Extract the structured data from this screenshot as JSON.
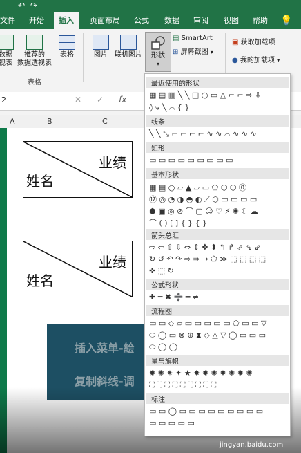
{
  "ribbon_tabs": [
    "文件",
    "开始",
    "插入",
    "页面布局",
    "公式",
    "数据",
    "审阅",
    "视图",
    "帮助"
  ],
  "active_tab": "插入",
  "ribbon": {
    "pivot_label": "数据\n视表",
    "recommended_pivot_label": "推荐的\n数据透视表",
    "table_label": "表格",
    "table_group": "表格",
    "picture_label": "图片",
    "online_picture_label": "联机图片",
    "shapes_label": "形状",
    "smartart_label": "SmartArt",
    "screenshot_label": "屏幕截图",
    "get_addins_label": "获取加载项",
    "my_addins_label": "我的加载项"
  },
  "formula_bar": {
    "name_box": "2",
    "fx": "fx"
  },
  "columns": [
    "A",
    "B",
    "C"
  ],
  "cells": [
    {
      "top_right": "业绩",
      "bottom_left": "姓名"
    },
    {
      "top_right": "业绩",
      "bottom_left": "姓名"
    }
  ],
  "banner_lines": [
    "插入菜单-絵",
    "复制斜线-调"
  ],
  "shapes_menu": {
    "sections": [
      "最近使用的形状",
      "线条",
      "矩形",
      "基本形状",
      "箭头总汇",
      "公式形状",
      "流程图",
      "星与旗帜",
      "标注"
    ],
    "recent_rows": [
      "▦ ▤ ▥ ╲ ╲ □ ○ ▭ △ ⌐ ⌐ ⇨ ⇩",
      "◊ ⤷ ╲ ⌒ { }"
    ],
    "lines_rows": [
      "╲ ╲ ⤡ ⌐ ⌐ ⌐ ⌐ ∿ ∿ ⌒ ∿ ∿ ∿"
    ],
    "rect_rows": [
      "▭ ▭ ▭ ▭ ▭ ▭ ▭ ▭ ▭"
    ],
    "basic_rows": [
      "▦ ▤ ○ ▱ ▲ ▱ ▭ ⬠ ⬡ ⬡ ⓪",
      "⑫ ◎ ◔ ◑ ◓ ◐ ⟋ ⬡ ▭ ▭ ▭ ▭",
      "⬢ ▣ ◎ ⊘ ⌒ ▢ ☺ ♡ ⚡ ✺ ☾ ☁",
      "⌒ ( ) [ ] { } { }"
    ],
    "arrow_rows": [
      "⇨ ⇦ ⇧ ⇩ ⇔ ⇕ ✥ ⬍ ↰ ↱ ⇗ ⇘ ⇙",
      "↻ ↺ ↶ ↷ ⇨ ⇛ ⇢ ⬠ ≫ ⬚ ⬚ ⬚ ⬚",
      "✜ ⬚ ↻"
    ],
    "equation_rows": [
      "✚ ━ ✖ ➗ ═ ≠"
    ],
    "flow_rows": [
      "▭ ▭ ◇ ▱ ▭ ▭ ▭ ▭ ▭ ⬠ ▭ ▭ ▽",
      "⬭ ◯ ▭ ⊗ ⊕ ⧗ ◇ △ ▽ ◯ ▭ ▭ ▭",
      "⬭ ◯ ◯"
    ],
    "star_rows": [
      "✹ ✺ ✷ ✦ ★ ✸ ✹ ✺ ✹ ✺ ✹ ✺",
      "⛶ ⛶ ⛶ ⛶ ⛶ ⛶ ⛶ ⛶ ⛶"
    ],
    "callout_rows": [
      "▭ ▭ ◯ ▭ ▭ ▭ ▭ ▭ ▭ ▭ ▭ ▭",
      "▭ ▭ ▭ ▭ ▭"
    ]
  },
  "watermark": "Bai 经验",
  "watermark_url": "jingyan.baidu.com",
  "colors": {
    "brand": "#217346",
    "banner": "#1d4f63"
  }
}
